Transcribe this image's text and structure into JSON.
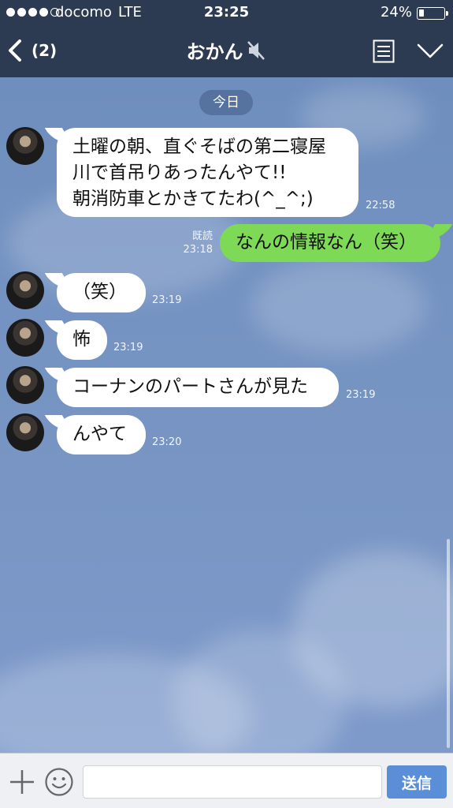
{
  "status_bar": {
    "carrier": "docomo",
    "network": "LTE",
    "time": "23:25",
    "battery": "24%",
    "battery_level": 0.24
  },
  "nav": {
    "back_count": "(2)",
    "title": "おかん",
    "muted_icon": "speaker-muted-icon",
    "menu_icon": "menu-icon",
    "collapse_icon": "chevron-down-icon"
  },
  "chat": {
    "date_label": "今日",
    "messages": [
      {
        "side": "in",
        "text": "土曜の朝、直ぐそばの第二寝屋\n川で首吊りあったんやて!!\n朝消防車とかきてたわ(^_^;)",
        "time": "22:58"
      },
      {
        "side": "out",
        "text": "なんの情報なん（笑）",
        "read": "既読",
        "time": "23:18"
      },
      {
        "side": "in",
        "text": "（笑）",
        "time": "23:19"
      },
      {
        "side": "in",
        "text": "怖",
        "time": "23:19"
      },
      {
        "side": "in",
        "text": "コーナンのパートさんが見た",
        "time": "23:19"
      },
      {
        "side": "in",
        "text": "んやて",
        "time": "23:20"
      }
    ]
  },
  "input": {
    "plus_icon": "plus-icon",
    "sticker_icon": "smiley-icon",
    "placeholder": "",
    "send_label": "送信"
  },
  "colors": {
    "header": "#2c3a52",
    "chat_background": "#7593c2",
    "outgoing_bubble": "#7ed957",
    "incoming_bubble": "#ffffff",
    "send_button": "#5a8fd8"
  }
}
